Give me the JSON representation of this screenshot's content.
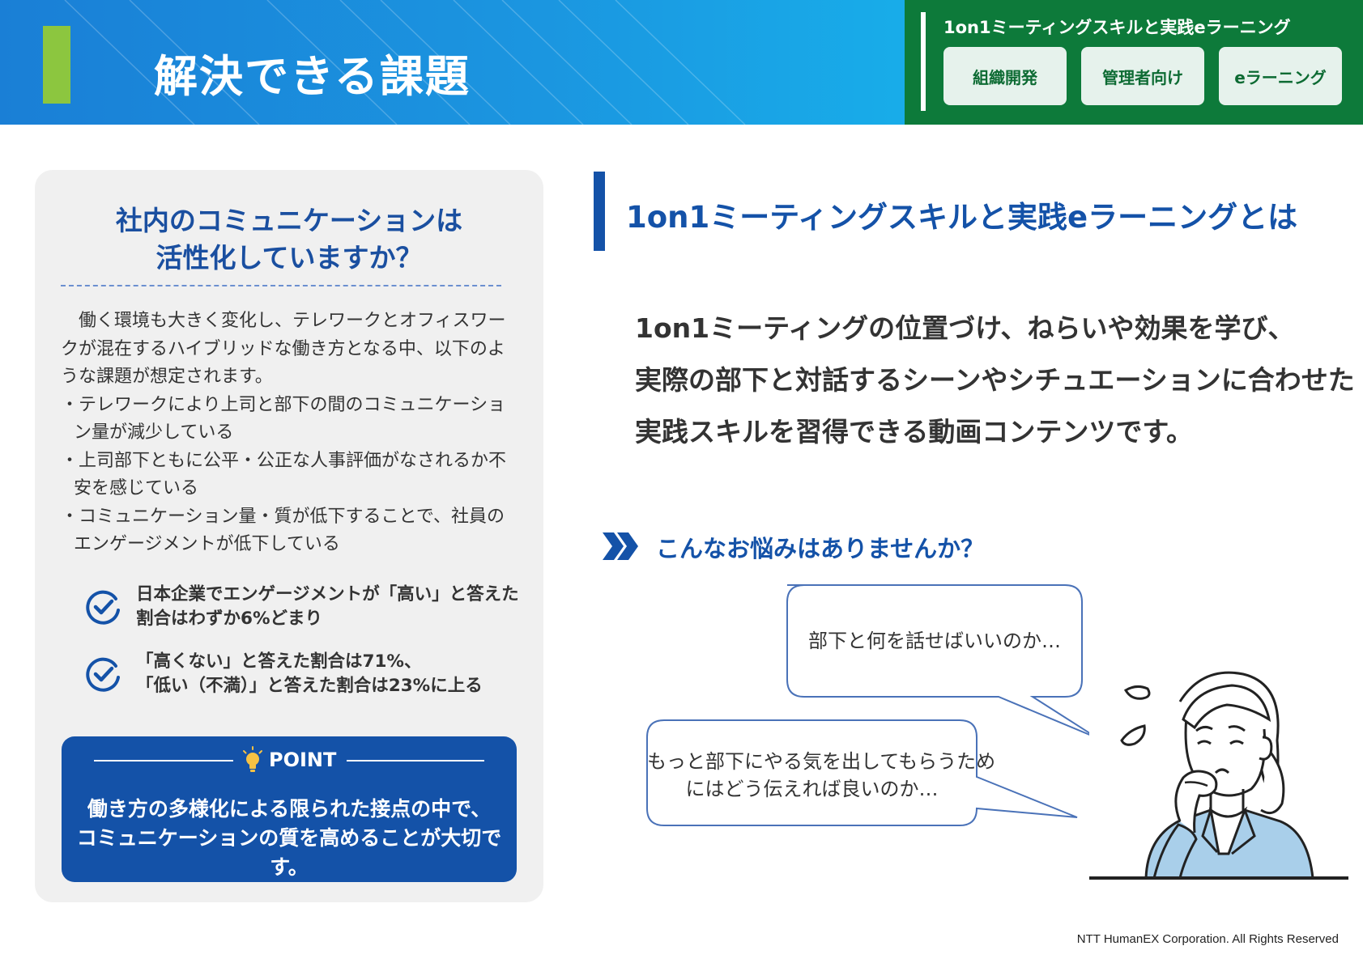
{
  "header": {
    "title": "解決できる課題",
    "course_name": "1on1ミーティングスキルと実践eラーニング",
    "tags": [
      "組織開発",
      "管理者向け",
      "eラーニング"
    ]
  },
  "left_card": {
    "question_line1": "社内のコミュニケーションは",
    "question_line2": "活性化していますか？",
    "intro": "働く環境も大きく変化し、テレワークとオフィスワークが混在するハイブリッドな働き方となる中、以下のような課題が想定されます。",
    "bullets": [
      "・テレワークにより上司と部下の間のコミュニケーション量が減少している",
      "・上司部下ともに公平・公正な人事評価がなされるか不安を感じている",
      "・コミュニケーション量・質が低下することで、社員のエンゲージメントが低下している"
    ],
    "checks": [
      {
        "line1": "日本企業でエンゲージメントが「高い」と答えた",
        "line2": "割合はわずか6%どまり"
      },
      {
        "line1": "「高くない」と答えた割合は71%、",
        "line2": "「低い（不満）」と答えた割合は23%に上る"
      }
    ],
    "point": {
      "label": "POINT",
      "line1": "働き方の多様化による限られた接点の中で、",
      "line2": "コミュニケーションの質を高めることが大切です。"
    }
  },
  "right": {
    "section_title": "1on1ミーティングスキルと実践eラーニングとは",
    "description": [
      "1on1ミーティングの位置づけ、ねらいや効果を学び、",
      "実際の部下と対話するシーンやシチュエーションに合わせた",
      "実践スキルを習得できる動画コンテンツです。"
    ],
    "worry_title": "こんなお悩みはありませんか？",
    "bubble1": "部下と何を話せばいいのか…",
    "bubble2_line1": "もっと部下にやる気を出してもらうため",
    "bubble2_line2": "にはどう伝えれば良いのか…"
  },
  "footer": {
    "copyright": "NTT HumanEX Corporation. All Rights Reserved"
  },
  "colors": {
    "header_blue": "#1a7fd6",
    "accent_green": "#8cc63f",
    "course_panel_green": "#0d7a3a",
    "brand_navy": "#1452a8",
    "card_gray": "#f0f0f0"
  },
  "icons": [
    "check-circle-icon",
    "lightbulb-icon",
    "double-chevron-icon",
    "worried-person-illustration"
  ]
}
